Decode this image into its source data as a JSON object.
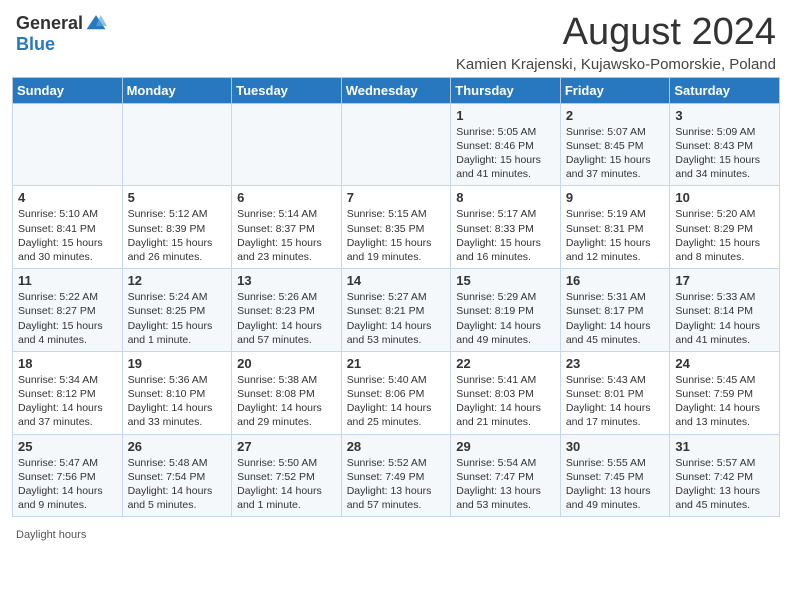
{
  "logo": {
    "general": "General",
    "blue": "Blue"
  },
  "title": "August 2024",
  "subtitle": "Kamien Krajenski, Kujawsko-Pomorskie, Poland",
  "days_of_week": [
    "Sunday",
    "Monday",
    "Tuesday",
    "Wednesday",
    "Thursday",
    "Friday",
    "Saturday"
  ],
  "weeks": [
    [
      {
        "day": "",
        "info": ""
      },
      {
        "day": "",
        "info": ""
      },
      {
        "day": "",
        "info": ""
      },
      {
        "day": "",
        "info": ""
      },
      {
        "day": "1",
        "info": "Sunrise: 5:05 AM\nSunset: 8:46 PM\nDaylight: 15 hours\nand 41 minutes."
      },
      {
        "day": "2",
        "info": "Sunrise: 5:07 AM\nSunset: 8:45 PM\nDaylight: 15 hours\nand 37 minutes."
      },
      {
        "day": "3",
        "info": "Sunrise: 5:09 AM\nSunset: 8:43 PM\nDaylight: 15 hours\nand 34 minutes."
      }
    ],
    [
      {
        "day": "4",
        "info": "Sunrise: 5:10 AM\nSunset: 8:41 PM\nDaylight: 15 hours\nand 30 minutes."
      },
      {
        "day": "5",
        "info": "Sunrise: 5:12 AM\nSunset: 8:39 PM\nDaylight: 15 hours\nand 26 minutes."
      },
      {
        "day": "6",
        "info": "Sunrise: 5:14 AM\nSunset: 8:37 PM\nDaylight: 15 hours\nand 23 minutes."
      },
      {
        "day": "7",
        "info": "Sunrise: 5:15 AM\nSunset: 8:35 PM\nDaylight: 15 hours\nand 19 minutes."
      },
      {
        "day": "8",
        "info": "Sunrise: 5:17 AM\nSunset: 8:33 PM\nDaylight: 15 hours\nand 16 minutes."
      },
      {
        "day": "9",
        "info": "Sunrise: 5:19 AM\nSunset: 8:31 PM\nDaylight: 15 hours\nand 12 minutes."
      },
      {
        "day": "10",
        "info": "Sunrise: 5:20 AM\nSunset: 8:29 PM\nDaylight: 15 hours\nand 8 minutes."
      }
    ],
    [
      {
        "day": "11",
        "info": "Sunrise: 5:22 AM\nSunset: 8:27 PM\nDaylight: 15 hours\nand 4 minutes."
      },
      {
        "day": "12",
        "info": "Sunrise: 5:24 AM\nSunset: 8:25 PM\nDaylight: 15 hours\nand 1 minute."
      },
      {
        "day": "13",
        "info": "Sunrise: 5:26 AM\nSunset: 8:23 PM\nDaylight: 14 hours\nand 57 minutes."
      },
      {
        "day": "14",
        "info": "Sunrise: 5:27 AM\nSunset: 8:21 PM\nDaylight: 14 hours\nand 53 minutes."
      },
      {
        "day": "15",
        "info": "Sunrise: 5:29 AM\nSunset: 8:19 PM\nDaylight: 14 hours\nand 49 minutes."
      },
      {
        "day": "16",
        "info": "Sunrise: 5:31 AM\nSunset: 8:17 PM\nDaylight: 14 hours\nand 45 minutes."
      },
      {
        "day": "17",
        "info": "Sunrise: 5:33 AM\nSunset: 8:14 PM\nDaylight: 14 hours\nand 41 minutes."
      }
    ],
    [
      {
        "day": "18",
        "info": "Sunrise: 5:34 AM\nSunset: 8:12 PM\nDaylight: 14 hours\nand 37 minutes."
      },
      {
        "day": "19",
        "info": "Sunrise: 5:36 AM\nSunset: 8:10 PM\nDaylight: 14 hours\nand 33 minutes."
      },
      {
        "day": "20",
        "info": "Sunrise: 5:38 AM\nSunset: 8:08 PM\nDaylight: 14 hours\nand 29 minutes."
      },
      {
        "day": "21",
        "info": "Sunrise: 5:40 AM\nSunset: 8:06 PM\nDaylight: 14 hours\nand 25 minutes."
      },
      {
        "day": "22",
        "info": "Sunrise: 5:41 AM\nSunset: 8:03 PM\nDaylight: 14 hours\nand 21 minutes."
      },
      {
        "day": "23",
        "info": "Sunrise: 5:43 AM\nSunset: 8:01 PM\nDaylight: 14 hours\nand 17 minutes."
      },
      {
        "day": "24",
        "info": "Sunrise: 5:45 AM\nSunset: 7:59 PM\nDaylight: 14 hours\nand 13 minutes."
      }
    ],
    [
      {
        "day": "25",
        "info": "Sunrise: 5:47 AM\nSunset: 7:56 PM\nDaylight: 14 hours\nand 9 minutes."
      },
      {
        "day": "26",
        "info": "Sunrise: 5:48 AM\nSunset: 7:54 PM\nDaylight: 14 hours\nand 5 minutes."
      },
      {
        "day": "27",
        "info": "Sunrise: 5:50 AM\nSunset: 7:52 PM\nDaylight: 14 hours\nand 1 minute."
      },
      {
        "day": "28",
        "info": "Sunrise: 5:52 AM\nSunset: 7:49 PM\nDaylight: 13 hours\nand 57 minutes."
      },
      {
        "day": "29",
        "info": "Sunrise: 5:54 AM\nSunset: 7:47 PM\nDaylight: 13 hours\nand 53 minutes."
      },
      {
        "day": "30",
        "info": "Sunrise: 5:55 AM\nSunset: 7:45 PM\nDaylight: 13 hours\nand 49 minutes."
      },
      {
        "day": "31",
        "info": "Sunrise: 5:57 AM\nSunset: 7:42 PM\nDaylight: 13 hours\nand 45 minutes."
      }
    ]
  ],
  "footer": "Daylight hours"
}
